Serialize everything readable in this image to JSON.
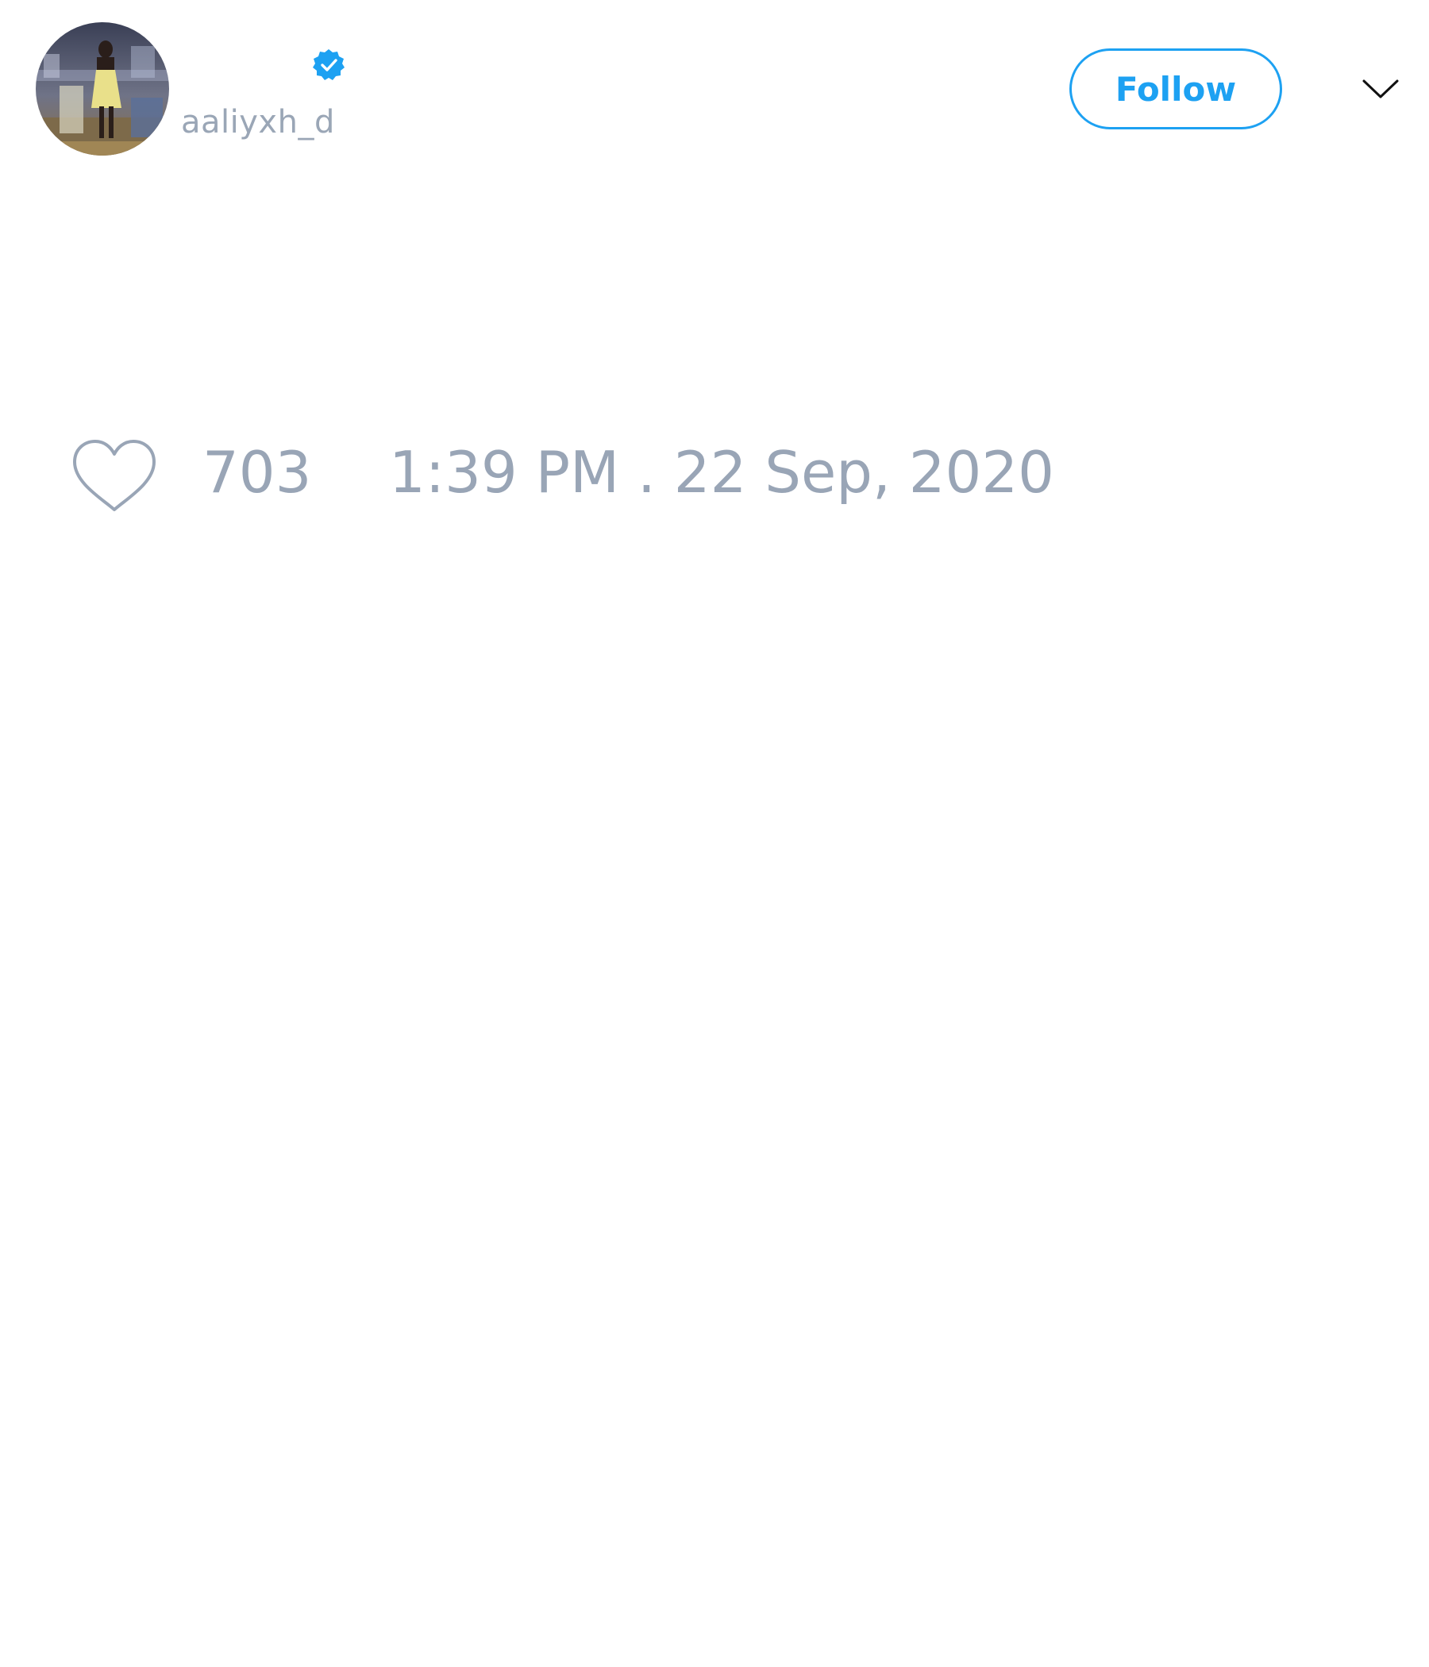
{
  "tweet": {
    "author": {
      "display_name": "",
      "handle": "aaliyxh_d",
      "verified_icon": "verified-badge-icon",
      "avatar_icon": "profile-photo"
    },
    "follow_label": "Follow",
    "menu_icon": "chevron-down-icon",
    "like_icon": "heart-icon",
    "like_count": "703",
    "timestamp": "1:39 PM . 22 Sep, 2020"
  },
  "colors": {
    "accent": "#1da1f2",
    "muted_text": "#99a5b6",
    "background": "#ffffff"
  }
}
